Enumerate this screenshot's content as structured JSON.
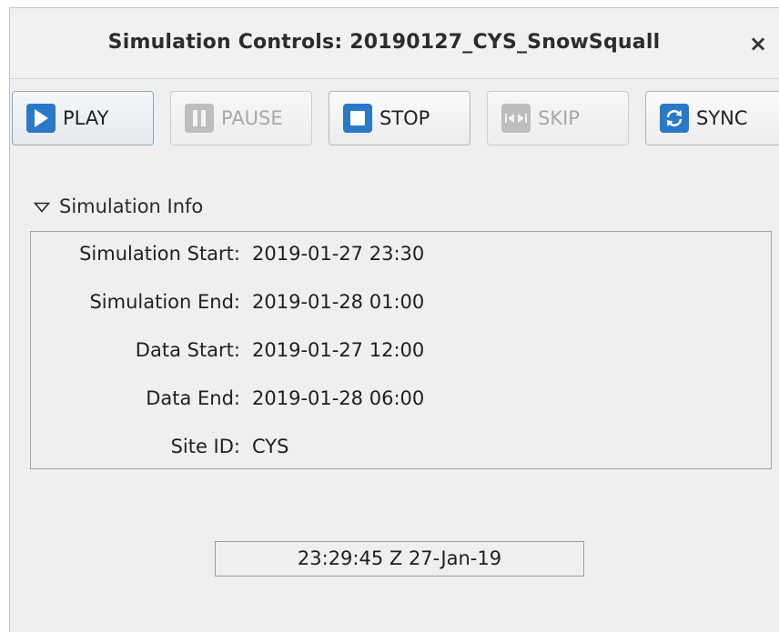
{
  "window": {
    "title": "Simulation Controls: 20190127_CYS_SnowSquall",
    "close_label": "×"
  },
  "toolbar": {
    "buttons": [
      {
        "label": "PLAY",
        "icon": "play-icon",
        "enabled": true
      },
      {
        "label": "PAUSE",
        "icon": "pause-icon",
        "enabled": false
      },
      {
        "label": "STOP",
        "icon": "stop-icon",
        "enabled": true
      },
      {
        "label": "SKIP",
        "icon": "skip-icon",
        "enabled": false
      },
      {
        "label": "SYNC",
        "icon": "sync-icon",
        "enabled": true
      }
    ]
  },
  "info": {
    "header": "Simulation Info",
    "toggle_icon": "triangle-down-icon",
    "rows": [
      {
        "label": "Simulation Start:",
        "value": "2019-01-27 23:30"
      },
      {
        "label": "Simulation End:",
        "value": "2019-01-28 01:00"
      },
      {
        "label": "Data Start:",
        "value": "2019-01-27 12:00"
      },
      {
        "label": "Data End:",
        "value": "2019-01-28 06:00"
      },
      {
        "label": "Site ID:",
        "value": "CYS"
      }
    ]
  },
  "clock": {
    "display": "23:29:45 Z 27-Jan-19"
  },
  "colors": {
    "accent": "#2a79c9",
    "disabled_icon": "#bdbdbd",
    "background": "#efefef"
  }
}
